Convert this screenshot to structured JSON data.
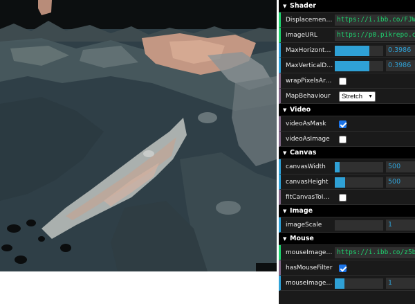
{
  "gui": {
    "folders": [
      {
        "title": "Shader",
        "rows": [
          {
            "kind": "string",
            "label": "DisplacementM...",
            "value": "https://i.ibb.co/FJWXGG"
          },
          {
            "kind": "string",
            "label": "imageURL",
            "value": "https://p0.pikrepo.com/pre"
          },
          {
            "kind": "slider",
            "label": "MaxHorizontalD...",
            "value": "0.3986",
            "level": 0.72
          },
          {
            "kind": "slider",
            "label": "MaxVerticalDisp...",
            "value": "0.3986",
            "level": 0.72
          },
          {
            "kind": "checkbox",
            "label": "wrapPixelsAround",
            "checked": false
          },
          {
            "kind": "select",
            "label": "MapBehaviour",
            "value": "Stretch"
          }
        ]
      },
      {
        "title": "Video",
        "rows": [
          {
            "kind": "checkbox",
            "label": "videoAsMask",
            "checked": true
          },
          {
            "kind": "checkbox",
            "label": "videoAsImage",
            "checked": false
          }
        ]
      },
      {
        "title": "Canvas",
        "rows": [
          {
            "kind": "slider",
            "label": "canvasWidth",
            "value": "500",
            "level": 0.1
          },
          {
            "kind": "slider",
            "label": "canvasHeight",
            "value": "500",
            "level": 0.22
          },
          {
            "kind": "checkbox",
            "label": "fitCanvasToImage",
            "checked": false
          }
        ]
      },
      {
        "title": "Image",
        "rows": [
          {
            "kind": "slider",
            "label": "imageScale",
            "value": "1",
            "level": 0.0
          }
        ]
      },
      {
        "title": "Mouse",
        "rows": [
          {
            "kind": "string",
            "label": "mouseImageURL",
            "value": "https://i.ibb.co/z5bDmdq"
          },
          {
            "kind": "checkbox",
            "label": "hasMouseFilter",
            "checked": true
          },
          {
            "kind": "slider",
            "label": "mouseImageScale",
            "value": "1",
            "level": 0.2
          }
        ]
      }
    ]
  },
  "colors": {
    "number_accent": "#2fa1d6",
    "string_accent": "#1ed36f",
    "boolean_accent": "#806787",
    "panel_bg": "#1a1a1a",
    "folder_bg": "#000000"
  },
  "icons": {
    "folder_open": "triangle-down-icon"
  }
}
